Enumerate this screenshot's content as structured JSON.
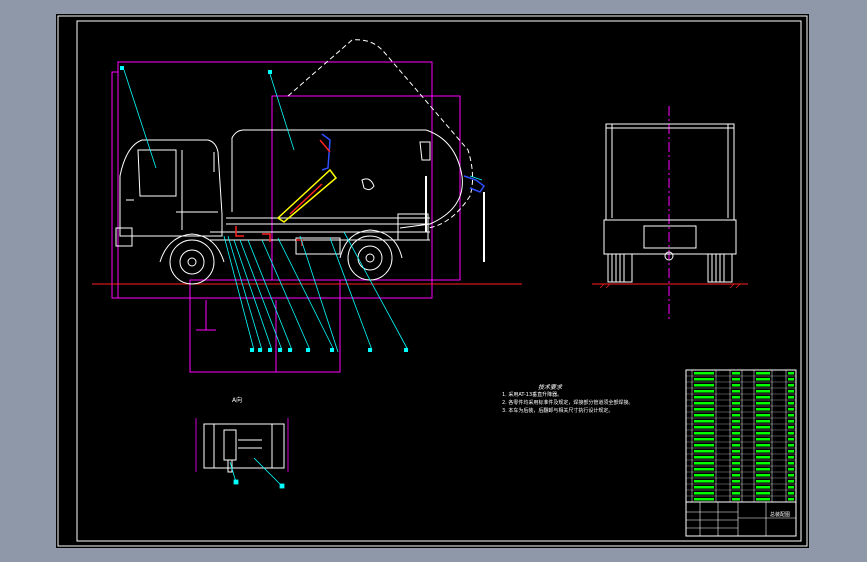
{
  "drawing": {
    "colors": {
      "background": "#000000",
      "frame": "#ffffff",
      "outline": "#ff00ff",
      "body": "#ffffff",
      "leader": "#00ffff",
      "ground": "#ff0000",
      "hydraulic_red": "#ff2020",
      "hydraulic_blue": "#3050ff",
      "hydraulic_yellow": "#ffff00",
      "table_text": "#00ff00",
      "screen_margin": "#8f98a8"
    },
    "views": {
      "side_view": "side-elevation",
      "rear_view": "rear-elevation",
      "detail_view": "detail-section"
    },
    "detail": {
      "label": "A向"
    },
    "notes": {
      "title": "技术要求",
      "items": [
        "1. 采用AT-13垂直升降器。",
        "2. 各零件均采用标准件及规定，焊接部分管道须全部焊接。",
        "3. 本车为后装，后翻卸与相关尺寸执行设计规定。"
      ]
    },
    "title_block": {
      "drawing_title": "总装配图"
    }
  }
}
